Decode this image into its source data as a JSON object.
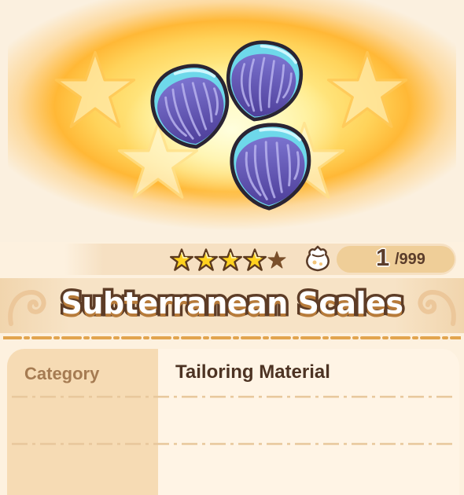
{
  "item": {
    "name": "Subterranean Scales",
    "image_icon": "purple-scales-icon",
    "rarity": {
      "filled_stars": 4,
      "max_stars": 5
    },
    "owned": {
      "current": "1",
      "max": "/999",
      "bag_icon": "item-bag-icon"
    }
  },
  "details": {
    "rows": [
      {
        "label": "Category",
        "value": "Tailoring Material"
      },
      {
        "label": "",
        "value": ""
      },
      {
        "label": "",
        "value": ""
      }
    ]
  },
  "colors": {
    "title_outline": "#5d3c26",
    "label_column": "#f6dbb4",
    "value_column": "#fff4e5",
    "star_filled": "#ffd21f",
    "star_empty": "#7a4f2a",
    "divider": "#e2a44e"
  }
}
